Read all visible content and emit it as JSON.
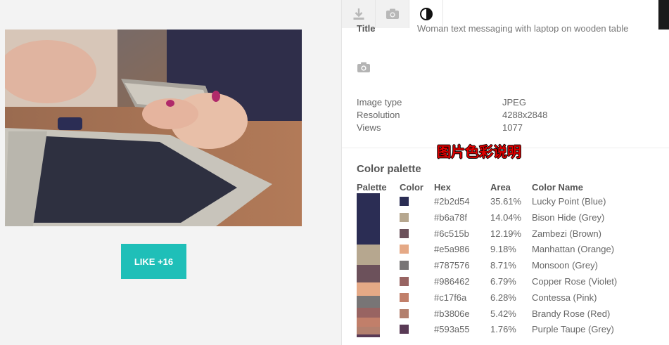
{
  "like_button": {
    "label": "LIKE +16"
  },
  "tabs": [
    {
      "icon": "download-icon",
      "active": false
    },
    {
      "icon": "camera-icon",
      "active": false
    },
    {
      "icon": "contrast-icon",
      "active": true
    }
  ],
  "details": {
    "title_label": "Title",
    "title_value": "Woman text messaging with laptop on wooden table",
    "image_type_label": "Image type",
    "image_type_value": "JPEG",
    "resolution_label": "Resolution",
    "resolution_value": "4288x2848",
    "views_label": "Views",
    "views_value": "1077"
  },
  "annotation": "图片色彩说明",
  "palette": {
    "title": "Color palette",
    "headers": {
      "palette": "Palette",
      "color": "Color",
      "hex": "Hex",
      "area": "Area",
      "name": "Color Name"
    },
    "colors": [
      {
        "hex": "#2b2d54",
        "area": "35.61%",
        "name": "Lucky Point (Blue)",
        "share": 35.61
      },
      {
        "hex": "#b6a78f",
        "area": "14.04%",
        "name": "Bison Hide (Grey)",
        "share": 14.04
      },
      {
        "hex": "#6c515b",
        "area": "12.19%",
        "name": "Zambezi (Brown)",
        "share": 12.19
      },
      {
        "hex": "#e5a986",
        "area": "9.18%",
        "name": "Manhattan (Orange)",
        "share": 9.18
      },
      {
        "hex": "#787576",
        "area": "8.71%",
        "name": "Monsoon (Grey)",
        "share": 8.71
      },
      {
        "hex": "#986462",
        "area": "6.79%",
        "name": "Copper Rose (Violet)",
        "share": 6.79
      },
      {
        "hex": "#c17f6a",
        "area": "6.28%",
        "name": "Contessa (Pink)",
        "share": 6.28
      },
      {
        "hex": "#b3806e",
        "area": "5.42%",
        "name": "Brandy Rose (Red)",
        "share": 5.42
      },
      {
        "hex": "#593a55",
        "area": "1.76%",
        "name": "Purple Taupe (Grey)",
        "share": 1.76
      }
    ]
  }
}
